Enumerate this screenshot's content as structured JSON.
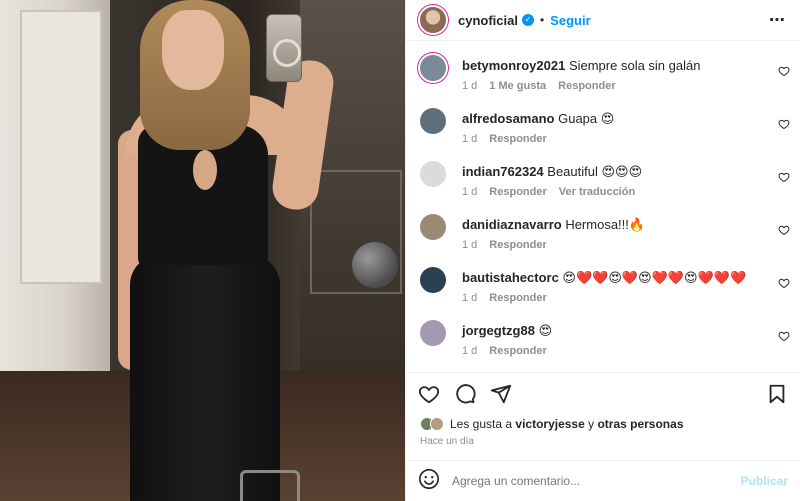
{
  "post": {
    "username": "cynoficial",
    "verified_icon": "✓",
    "separator": "•",
    "follow_label": "Seguir",
    "more_icon": "more-horizontal-icon",
    "more_glyph": "⋯"
  },
  "comments": [
    {
      "user": "betymonroy2021",
      "text": " Siempre sola sin galán",
      "time": "1 d",
      "likes": "1 Me gusta",
      "reply": "Responder",
      "translate": "",
      "avatar_color": "#7a8a96"
    },
    {
      "user": "alfredosamano",
      "text": " Guapa 😍",
      "time": "1 d",
      "likes": "",
      "reply": "Responder",
      "translate": "",
      "avatar_color": "#5d6f7a"
    },
    {
      "user": "indian762324",
      "text": " Beautiful 😍😍😍",
      "time": "1 d",
      "likes": "",
      "reply": "Responder",
      "translate": "Ver traducción",
      "avatar_color": "#dbdbdb"
    },
    {
      "user": "danidiaznavarro",
      "text": " Hermosa!!!🔥",
      "time": "1 d",
      "likes": "",
      "reply": "Responder",
      "translate": "",
      "avatar_color": "#9a8a73"
    },
    {
      "user": "bautistahectorc",
      "text": " 😍❤️❤️😍❤️😍❤️❤️😍❤️❤️❤️",
      "time": "1 d",
      "likes": "",
      "reply": "Responder",
      "translate": "",
      "avatar_color": "#2d4050"
    },
    {
      "user": "jorgegtzg88",
      "text": " 😍",
      "time": "1 d",
      "likes": "",
      "reply": "Responder",
      "translate": "",
      "avatar_color": "#a39ab0"
    }
  ],
  "likes": {
    "prefix": "Les gusta a ",
    "user": "victoryjesse",
    "middle": " y ",
    "others": "otras personas",
    "time": "Hace un día"
  },
  "composer": {
    "placeholder": "Agrega un comentario...",
    "publish_label": "Publicar"
  },
  "colors": {
    "accent": "#0095f6",
    "muted": "#8e8e8e",
    "publish_disabled": "#b2dffc"
  }
}
